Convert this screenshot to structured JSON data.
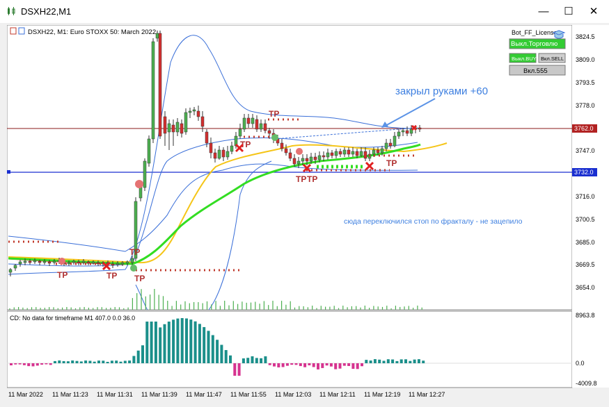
{
  "window": {
    "title": "DSXH22,M1",
    "minimize_icon": "—",
    "maximize_icon": "☐",
    "close_icon": "✕"
  },
  "chart": {
    "header": "DSXH22, M1:  Euro STOXX 50: March 2022",
    "license_label": "Bot_FF_License",
    "btn_trade_off": "Выкл.Торговлю",
    "btn_buy": "Выкл.BUY",
    "btn_sell": "Вкл.SELL",
    "btn_555": "Вкл.555",
    "annotation_closed": "закрыл руками +60",
    "annotation_stop": "сюда переключился стоп по фракталу - не зацепило",
    "tp_label": "TP",
    "price_current": "3762.0",
    "price_line2": "3732.0",
    "indicator_label": "CD: No data for timeframe M1 407.0 0.0 36.0"
  },
  "colors": {
    "up_candle": "#4caf50",
    "down_candle": "#d32f2f",
    "bollinger": "#3a6fd8",
    "ma_green": "#33dd22",
    "ma_yellow": "#f5c518",
    "ma_red": "#e53935",
    "tp_dots": "#c0392b",
    "histogram_pos": "#1a8f8a",
    "histogram_neg": "#d6338f",
    "annotation": "#3d7fe0",
    "current_price_tag": "#b22222",
    "level_price_tag": "#1a2fd0"
  },
  "chart_data": {
    "type": "candlestick",
    "price_axis": [
      "3824.5",
      "3809.0",
      "3793.5",
      "3778.0",
      "3762.0",
      "3747.0",
      "3732.0",
      "3716.0",
      "3700.5",
      "3685.0",
      "3669.5",
      "3654.0"
    ],
    "indicator_axis": [
      "8963.8",
      "0.0",
      "-4009.8"
    ],
    "time_axis": [
      "11 Mar 2022",
      "11 Mar 11:23",
      "11 Mar 11:31",
      "11 Mar 11:39",
      "11 Mar 11:47",
      "11 Mar 11:55",
      "11 Mar 12:03",
      "11 Mar 12:11",
      "11 Mar 12:19",
      "11 Mar 12:27"
    ]
  }
}
